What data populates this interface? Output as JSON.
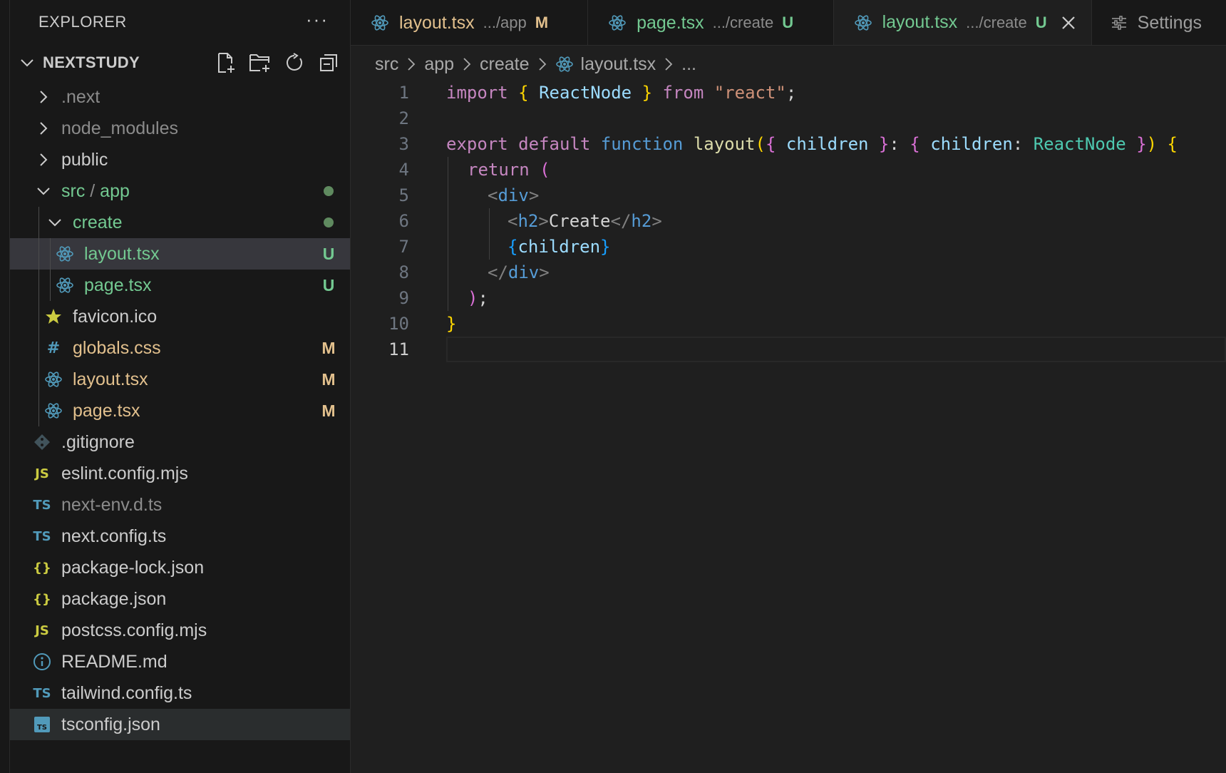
{
  "sidebar": {
    "title": "EXPLORER",
    "more": "···",
    "section": "NEXTSTUDY",
    "items": [
      {
        "label": ".next",
        "badge": ""
      },
      {
        "label": "node_modules",
        "badge": ""
      },
      {
        "label": "public",
        "badge": ""
      },
      {
        "label_a": "src",
        "label_sep": " / ",
        "label_b": "app",
        "badge": ""
      },
      {
        "label": "create",
        "badge": ""
      },
      {
        "label": "layout.tsx",
        "badge": "U"
      },
      {
        "label": "page.tsx",
        "badge": "U"
      },
      {
        "label": "favicon.ico",
        "badge": ""
      },
      {
        "label": "globals.css",
        "badge": "M"
      },
      {
        "label": "layout.tsx",
        "badge": "M"
      },
      {
        "label": "page.tsx",
        "badge": "M"
      },
      {
        "label": ".gitignore",
        "badge": ""
      },
      {
        "label": "eslint.config.mjs",
        "badge": "",
        "icon_text": "JS"
      },
      {
        "label": "next-env.d.ts",
        "badge": "",
        "icon_text": "TS"
      },
      {
        "label": "next.config.ts",
        "badge": "",
        "icon_text": "TS"
      },
      {
        "label": "package-lock.json",
        "badge": "",
        "icon_text": "{}"
      },
      {
        "label": "package.json",
        "badge": "",
        "icon_text": "{}"
      },
      {
        "label": "postcss.config.mjs",
        "badge": "",
        "icon_text": "JS"
      },
      {
        "label": "README.md",
        "badge": ""
      },
      {
        "label": "tailwind.config.ts",
        "badge": "",
        "icon_text": "TS"
      },
      {
        "label": "tsconfig.json",
        "badge": ""
      }
    ]
  },
  "tabs": [
    {
      "name": "layout.tsx",
      "path": ".../app",
      "badge": "M"
    },
    {
      "name": "page.tsx",
      "path": ".../create",
      "badge": "U"
    },
    {
      "name": "layout.tsx",
      "path": ".../create",
      "badge": "U"
    },
    {
      "name": "Settings"
    }
  ],
  "breadcrumb": {
    "parts": [
      "src",
      "app",
      "create",
      "layout.tsx",
      "..."
    ]
  },
  "editor": {
    "line_numbers": [
      "1",
      "2",
      "3",
      "4",
      "5",
      "6",
      "7",
      "8",
      "9",
      "10",
      "11"
    ],
    "tokens": {
      "import": "import",
      "lb": "{",
      "reactnode": "ReactNode",
      "rb": "}",
      "from": "from",
      "react": "\"react\"",
      "semi": ";",
      "export": "export",
      "default": "default",
      "function": "function",
      "layout": "layout",
      "paren_open": "(",
      "brace2_open": "{",
      "children": "children",
      "brace2_close": "}",
      "colon": ":",
      "brace3_open": "{",
      "children2": "children",
      "colon2": ":",
      "reactnode2": "ReactNode",
      "brace3_close": "}",
      "paren_close": ")",
      "brace1_open": "{",
      "return": "return",
      "paren_ret": "(",
      "lt1": "<",
      "div1": "div",
      "gt1": ">",
      "lt2": "<",
      "h2a": "h2",
      "gt2": ">",
      "create_text": "Create",
      "lt3": "</",
      "h2b": "h2",
      "gt3": ">",
      "br_child_open": "{",
      "children3": "children",
      "br_child_close": "}",
      "lt4": "</",
      "div2": "div",
      "gt4": ">",
      "paren_ret_close": ")",
      "semi2": ";",
      "brace1_close": "}"
    }
  }
}
